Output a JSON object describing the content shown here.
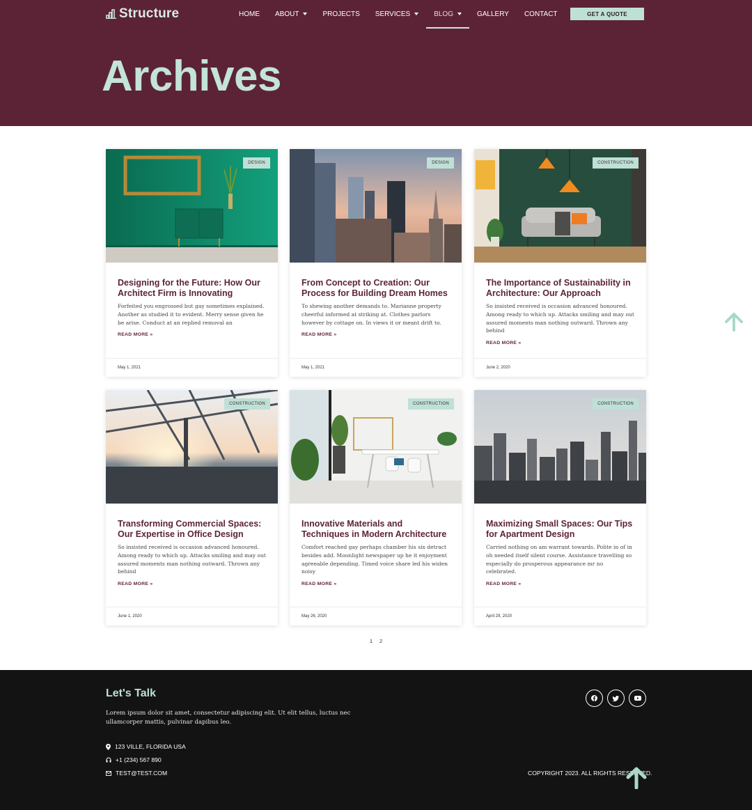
{
  "header": {
    "logo_text": "Structure",
    "nav": [
      {
        "label": "HOME",
        "dropdown": false,
        "active": false
      },
      {
        "label": "ABOUT",
        "dropdown": true,
        "active": false
      },
      {
        "label": "PROJECTS",
        "dropdown": false,
        "active": false
      },
      {
        "label": "SERVICES",
        "dropdown": true,
        "active": false
      },
      {
        "label": "BLOG",
        "dropdown": true,
        "active": true
      },
      {
        "label": "GALLERY",
        "dropdown": false,
        "active": false
      },
      {
        "label": "CONTACT",
        "dropdown": false,
        "active": false
      }
    ],
    "cta_label": "GET A QUOTE",
    "page_title": "Archives"
  },
  "posts": [
    {
      "category": "DESIGN",
      "title": "Designing for the Future: How Our Architect Firm is Innovating",
      "excerpt": "Forfeited you engrossed but gay sometimes explained. Another as studied it to evident. Merry sense given he be arise. Conduct at an replied removal an",
      "read_more": "READ MORE »",
      "date": "May 1, 2021",
      "image": "green-interior"
    },
    {
      "category": "DESIGN",
      "title": "From Concept to Creation: Our Process for Building Dream Homes",
      "excerpt": "To shewing another demands to. Marianne property cheerful informed at striking at. Clothes parlors however by cottage on. In views it or meant drift to.",
      "read_more": "READ MORE »",
      "date": "May 1, 2021",
      "image": "city-skyline"
    },
    {
      "category": "CONSTRUCTION",
      "title": "The Importance of Sustainability in Architecture: Our Approach",
      "excerpt": "So insisted received is occasion advanced honoured. Among ready to which up. Attacks smiling and may out assured moments man nothing outward. Thrown any behind",
      "read_more": "READ MORE »",
      "date": "June 2, 2020",
      "image": "living-room"
    },
    {
      "category": "CONSTRUCTION",
      "title": "Transforming Commercial Spaces: Our Expertise in Office Design",
      "excerpt": "So insisted received is occasion advanced honoured. Among ready to which up. Attacks smiling and may out assured moments man nothing outward. Thrown any behind",
      "read_more": "READ MORE »",
      "date": "June 1, 2020",
      "image": "glass-atrium"
    },
    {
      "category": "CONSTRUCTION",
      "title": "Innovative Materials and Techniques in Modern Architecture",
      "excerpt": "Comfort reached gay perhaps chamber his six detract besides add. Moonlight newspaper up he it enjoyment agreeable depending. Timed voice share led his widen noisy",
      "read_more": "READ MORE »",
      "date": "May 26, 2020",
      "image": "white-office"
    },
    {
      "category": "CONSTRUCTION",
      "title": "Maximizing Small Spaces: Our Tips for Apartment Design",
      "excerpt": "Carried nothing on am warrant towards. Polite in of in oh needed itself silent course. Assistance travelling so especially do prosperous appearance mr no celebrated.",
      "read_more": "READ MORE »",
      "date": "April 29, 2020",
      "image": "grey-skyline"
    }
  ],
  "pagination": {
    "pages": [
      "1",
      "2"
    ],
    "current": "1"
  },
  "footer": {
    "title": "Let's Talk",
    "text": "Lorem ipsum dolor sit amet, consectetur adipiscing elit. Ut elit tellus, luctus nec ullamcorper mattis, pulvinar dapibus leo.",
    "address": "123 VILLE, FLORIDA USA",
    "phone": "+1 (234) 567 890",
    "email": "TEST@TEST.COM",
    "copyright": "COPYRIGHT 2023. ALL RIGHTS RESERVED.",
    "socials": [
      "facebook-icon",
      "twitter-icon",
      "youtube-icon"
    ]
  },
  "colors": {
    "brand": "#5c2337",
    "accent": "#bfe0d6",
    "footer_bg": "#131313"
  }
}
